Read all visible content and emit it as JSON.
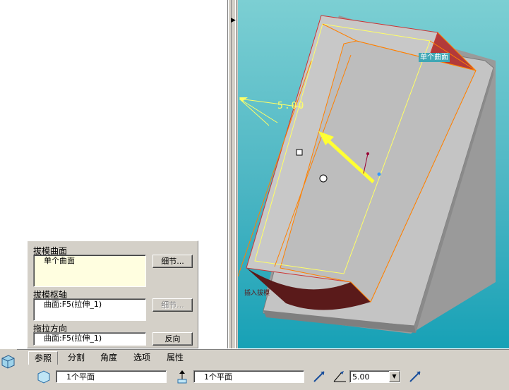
{
  "panel": {
    "draft_surface_label": "拔模曲面",
    "draft_surface_item": "单个曲面",
    "detail_button": "细节...",
    "draft_hinge_label": "拔模枢轴",
    "draft_hinge_item": "曲面:F5(拉伸_1)",
    "detail_button_disabled": "细节...",
    "pull_direction_label": "拖拉方向",
    "pull_direction_item": "曲面:F5(拉伸_1)",
    "reverse_button": "反向"
  },
  "tabs": [
    "参照",
    "分割",
    "角度",
    "选项",
    "属性"
  ],
  "dashboard": {
    "surface_field": "1个平面",
    "direction_field": "1个平面",
    "angle_value": "5.00"
  },
  "viewport": {
    "angle_dimension": "5.00",
    "single_surface_tag": "单个曲面",
    "insert_label": "插入拔模"
  },
  "colors": {
    "viewport_top": "#7ccfd3",
    "viewport_bottom": "#17a1b6",
    "part_gray": "#c8c8c8",
    "part_red": "#b23a3a",
    "edge_orange": "#ff8000",
    "edge_yellow": "#ffff66"
  }
}
